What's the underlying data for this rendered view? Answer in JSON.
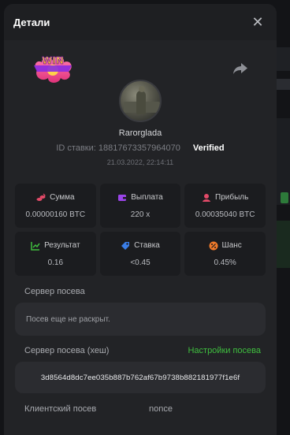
{
  "modal": {
    "title": "Детали",
    "close_glyph": "✕"
  },
  "player": {
    "username": "Rarorglada",
    "bet_id": "ID ставки: 1881767335796407​0",
    "verified": "Verified",
    "time": "21.03.2022, 22:14:11"
  },
  "stats": [
    {
      "label": "Сумма",
      "value": "0.00000160 BTC",
      "icon": "coins-icon",
      "color": "#e24a68"
    },
    {
      "label": "Выплата",
      "value": "220 x",
      "icon": "wallet-icon",
      "color": "#9a44e8"
    },
    {
      "label": "Прибыль",
      "value": "0.00035040 BTC",
      "icon": "profit-icon",
      "color": "#e24a68"
    },
    {
      "label": "Результат",
      "value": "0.16",
      "icon": "result-icon",
      "color": "#3fbf3f"
    },
    {
      "label": "Ставка",
      "value": "<0.45",
      "icon": "bet-icon",
      "color": "#3a7ee8"
    },
    {
      "label": "Шанс",
      "value": "0.45%",
      "icon": "percent-icon",
      "color": "#f07a2a"
    }
  ],
  "server_seed": {
    "label": "Сервер посева",
    "value": "Посев еще не раскрыт."
  },
  "server_seed_hash": {
    "label": "Сервер посева (хеш)",
    "settings_link": "Настройки посева",
    "value": "3d8564d8dc7ee035b887b762af67b9738b882181977f1e6f"
  },
  "client_seed": {
    "label": "Клиентский посев",
    "nonce_label": "nonce"
  },
  "badge": {
    "text": "WIN"
  }
}
